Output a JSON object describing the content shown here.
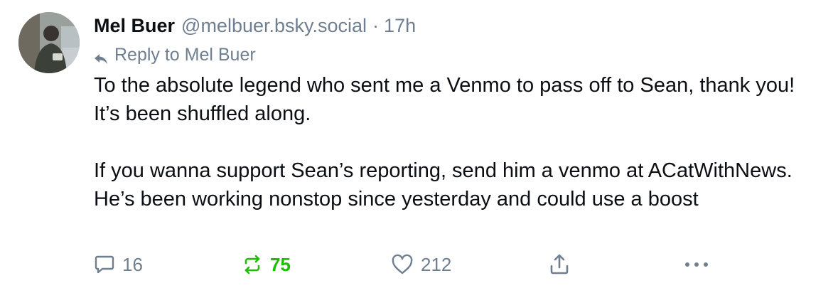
{
  "post": {
    "author": {
      "display_name": "Mel Buer",
      "handle": "@melbuer.bsky.social",
      "avatar_icon": "user-avatar-photo"
    },
    "separator": "·",
    "timestamp": "17h",
    "reply_to": {
      "icon": "reply-arrow-icon",
      "text": "Reply to Mel Buer"
    },
    "body": {
      "paragraph_1": "To the absolute legend who sent me a Venmo to pass off to Sean, thank you! It’s been shuffled along.",
      "paragraph_2": "If you wanna support Sean’s reporting, send him a venmo at ACatWithNews. He’s been working nonstop since yesterday and could use a boost"
    },
    "actions": {
      "reply_count": "16",
      "repost_count": "75",
      "like_count": "212"
    }
  },
  "colors": {
    "text": "#0b0f14",
    "muted": "#6f7f90",
    "repost_active": "#20bc07",
    "background": "#ffffff"
  }
}
